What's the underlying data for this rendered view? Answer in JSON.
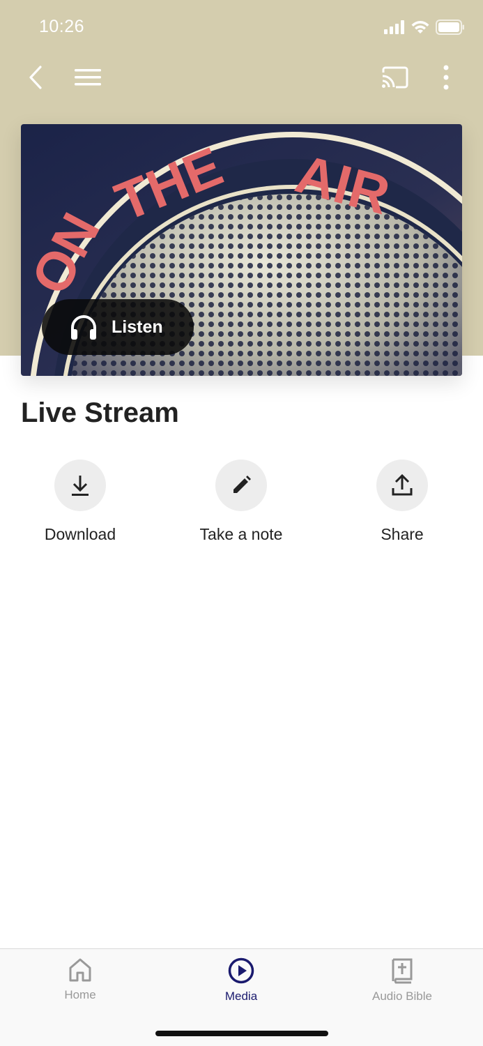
{
  "status_bar": {
    "time": "10:26"
  },
  "hero": {
    "listen_label": "Listen"
  },
  "page": {
    "title": "Live Stream"
  },
  "actions": [
    {
      "label": "Download",
      "icon": "download-icon"
    },
    {
      "label": "Take a note",
      "icon": "pencil-icon"
    },
    {
      "label": "Share",
      "icon": "share-icon"
    }
  ],
  "tabs": [
    {
      "label": "Home",
      "icon": "home-icon",
      "active": false
    },
    {
      "label": "Media",
      "icon": "play-circle-icon",
      "active": true
    },
    {
      "label": "Audio Bible",
      "icon": "bible-icon",
      "active": false
    }
  ],
  "colors": {
    "header_bg": "#d4cdae",
    "active_tab": "#1a1a6e",
    "inactive_tab": "#999999",
    "action_circle": "#ededed"
  }
}
